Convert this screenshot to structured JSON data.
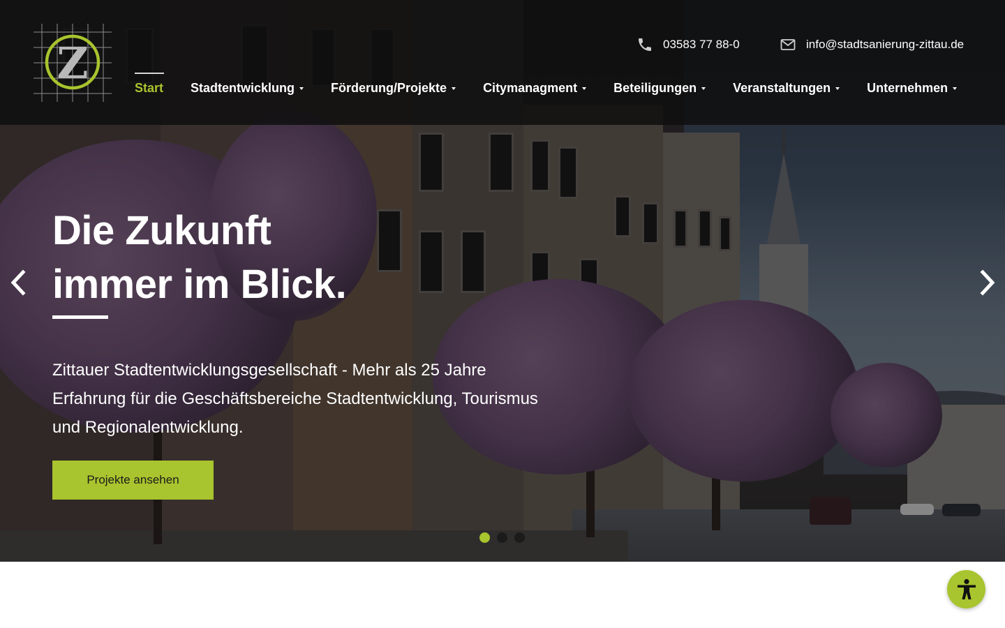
{
  "brand": {
    "logo_letter": "Z",
    "accent_color": "#a8c42e"
  },
  "contact": {
    "phone": "03583 77 88-0",
    "phone_icon": "phone-icon",
    "email": "info@stadtsanierung-zittau.de",
    "email_icon": "mail-icon"
  },
  "nav": {
    "items": [
      {
        "label": "Start",
        "active": true,
        "dropdown": false
      },
      {
        "label": "Stadtentwicklung",
        "active": false,
        "dropdown": true
      },
      {
        "label": "Förderung/Projekte",
        "active": false,
        "dropdown": true
      },
      {
        "label": "Citymanagment",
        "active": false,
        "dropdown": true
      },
      {
        "label": "Beteiligungen",
        "active": false,
        "dropdown": true
      },
      {
        "label": "Veranstaltungen",
        "active": false,
        "dropdown": true
      },
      {
        "label": "Unternehmen",
        "active": false,
        "dropdown": true
      }
    ]
  },
  "hero": {
    "headline_line1": "Die Zukunft",
    "headline_line2": "immer im Blick.",
    "lead": "Zittauer Stadtentwicklungsgesellschaft - Mehr als 25 Jahre Erfahrung für die Geschäftsbereiche Stadtentwicklung, Tourismus und Regionalentwicklung.",
    "cta_label": "Projekte ansehen",
    "prev_icon": "chevron-left-icon",
    "next_icon": "chevron-right-icon",
    "slides_total": 3,
    "slide_active": 1
  },
  "accessibility": {
    "icon": "accessibility-icon"
  }
}
